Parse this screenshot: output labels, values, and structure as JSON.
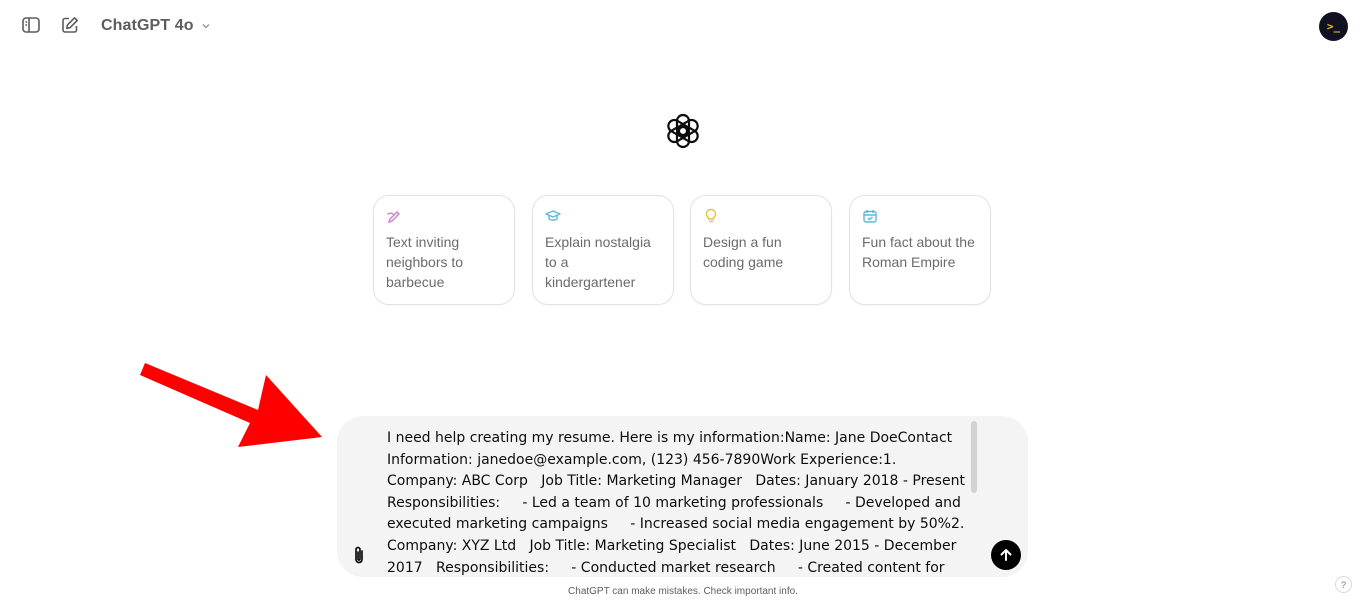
{
  "header": {
    "model_label": "ChatGPT 4o",
    "avatar_text": ">_"
  },
  "suggestions": [
    {
      "label": "Text inviting neighbors to barbecue",
      "icon": "pen-scribble-icon",
      "color": "#c77dd6"
    },
    {
      "label": "Explain nostalgia to a kindergartener",
      "icon": "graduation-cap-icon",
      "color": "#5bbad5"
    },
    {
      "label": "Design a fun coding game",
      "icon": "lightbulb-icon",
      "color": "#e2c541"
    },
    {
      "label": "Fun fact about the Roman Empire",
      "icon": "calendar-icon",
      "color": "#5bbad5"
    }
  ],
  "composer": {
    "text": "I need help creating my resume. Here is my information:Name: Jane DoeContact Information: janedoe@example.com, (123) 456-7890Work Experience:1. Company: ABC Corp   Job Title: Marketing Manager   Dates: January 2018 - Present   Responsibilities:     - Led a team of 10 marketing professionals     - Developed and executed marketing campaigns     - Increased social media engagement by 50%2. Company: XYZ Ltd   Job Title: Marketing Specialist   Dates: June 2015 - December 2017   Responsibilities:     - Conducted market research     - Created content for digital marketing     - Managed email marketing"
  },
  "footer": {
    "disclaimer": "ChatGPT can make mistakes. Check important info.",
    "help_label": "?"
  },
  "colors": {
    "arrow": "#ff0000",
    "send_button": "#000000",
    "composer_bg": "#f4f4f4"
  }
}
